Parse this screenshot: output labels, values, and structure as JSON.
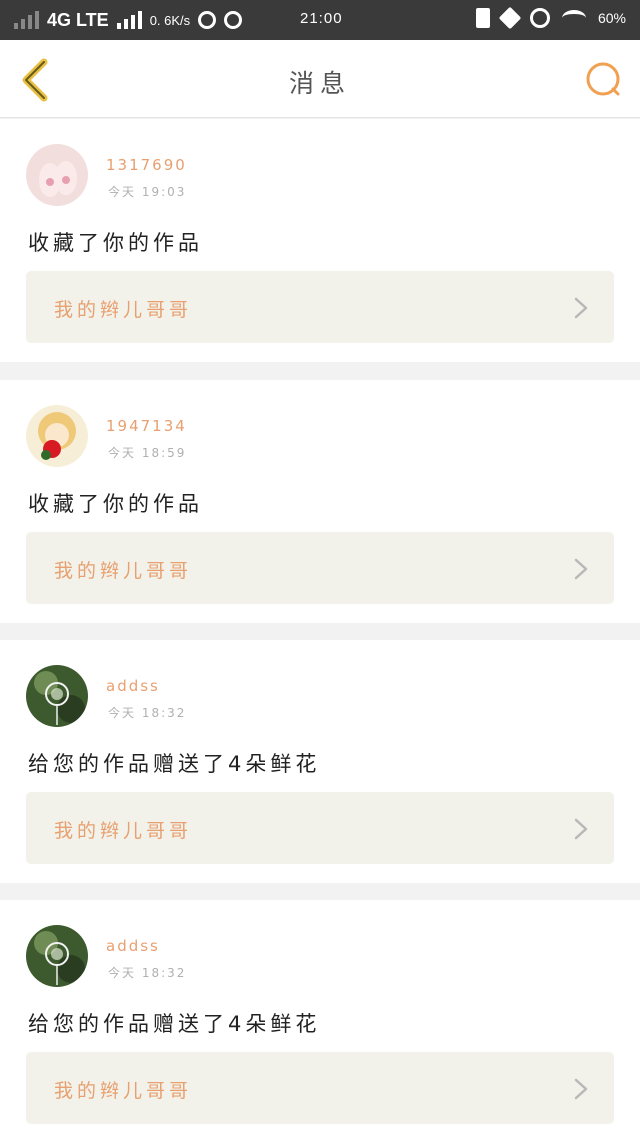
{
  "status_bar": {
    "network": "4G LTE",
    "speed": "0. 6K/s",
    "time": "21:00",
    "battery": "60%"
  },
  "header": {
    "title": "消息",
    "accent_color": "#f0a050"
  },
  "messages": [
    {
      "username": "1317690",
      "time": "今天 19:03",
      "action": "收藏了你的作品",
      "work_title": "我的辫儿哥哥",
      "avatar": "pink-slippers-avatar"
    },
    {
      "username": "1947134",
      "time": "今天 18:59",
      "action": "收藏了你的作品",
      "work_title": "我的辫儿哥哥",
      "avatar": "anime-girl-avatar"
    },
    {
      "username": "addss",
      "time": "今天 18:32",
      "action": "给您的作品赠送了4朵鲜花",
      "work_title": "我的辫儿哥哥",
      "avatar": "wind-chime-avatar"
    },
    {
      "username": "addss",
      "time": "今天 18:32",
      "action": "给您的作品赠送了4朵鲜花",
      "work_title": "我的辫儿哥哥",
      "avatar": "wind-chime-avatar"
    }
  ]
}
